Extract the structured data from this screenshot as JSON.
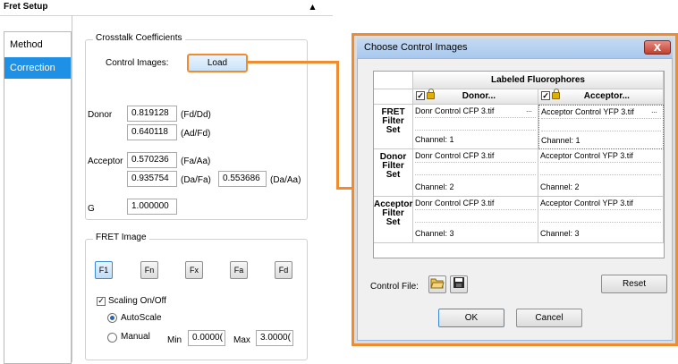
{
  "panel": {
    "title": "Fret Setup",
    "collapse_glyph": "▲",
    "sidebar": [
      {
        "label": "Method",
        "active": false
      },
      {
        "label": "Correction",
        "active": true
      }
    ]
  },
  "crosstalk": {
    "legend": "Crosstalk Coefficients",
    "control_images_label": "Control Images:",
    "load_label": "Load",
    "donor_label": "Donor",
    "donor_fd_dd": "0.819128",
    "donor_fd_dd_unit": "(Fd/Dd)",
    "donor_ad_fd": "0.640118",
    "donor_ad_fd_unit": "(Ad/Fd)",
    "acceptor_label": "Acceptor",
    "acceptor_fa_aa": "0.570236",
    "acceptor_fa_aa_unit": "(Fa/Aa)",
    "acceptor_da_fa": "0.935754",
    "acceptor_da_fa_unit": "(Da/Fa)",
    "acceptor_da_aa": "0.553686",
    "acceptor_da_aa_unit": "(Da/Aa)",
    "g_label": "G",
    "g_value": "1.000000"
  },
  "fret_image": {
    "legend": "FRET Image",
    "buttons": [
      "F1",
      "Fn",
      "Fx",
      "Fa",
      "Fd"
    ],
    "active_button": "F1",
    "scaling_label": "Scaling On/Off",
    "scaling_checked": true,
    "autoscale_label": "AutoScale",
    "manual_label": "Manual",
    "min_label": "Min",
    "min_value": "0.0000(",
    "max_label": "Max",
    "max_value": "3.0000("
  },
  "dialog": {
    "title": "Choose Control Images",
    "close_glyph": "X",
    "table_header": "Labeled Fluorophores",
    "col_donor": "Donor...",
    "col_acceptor": "Acceptor...",
    "rows": [
      {
        "label1": "FRET",
        "label2": "Filter",
        "label3": "Set",
        "donor_file": "Donr Control CFP 3.tif",
        "acceptor_file": "Acceptor Control YFP 3.tif",
        "donor_channel": "Channel: 1",
        "acceptor_channel": "Channel: 1"
      },
      {
        "label1": "Donor",
        "label2": "Filter",
        "label3": "Set",
        "donor_file": "Donr Control CFP 3.tif",
        "acceptor_file": "Acceptor Control YFP 3.tif",
        "donor_channel": "Channel: 2",
        "acceptor_channel": "Channel: 2"
      },
      {
        "label1": "Acceptor",
        "label2": "Filter",
        "label3": "Set",
        "donor_file": "Donr Control CFP 3.tif",
        "acceptor_file": "Acceptor Control YFP 3.tif",
        "donor_channel": "Channel: 3",
        "acceptor_channel": "Channel: 3"
      }
    ],
    "browse_glyph": "...",
    "control_file_label": "Control File:",
    "reset_label": "Reset",
    "ok_label": "OK",
    "cancel_label": "Cancel"
  },
  "colors": {
    "accent_orange": "#f08c30",
    "sidebar_active": "#1e90e6"
  }
}
